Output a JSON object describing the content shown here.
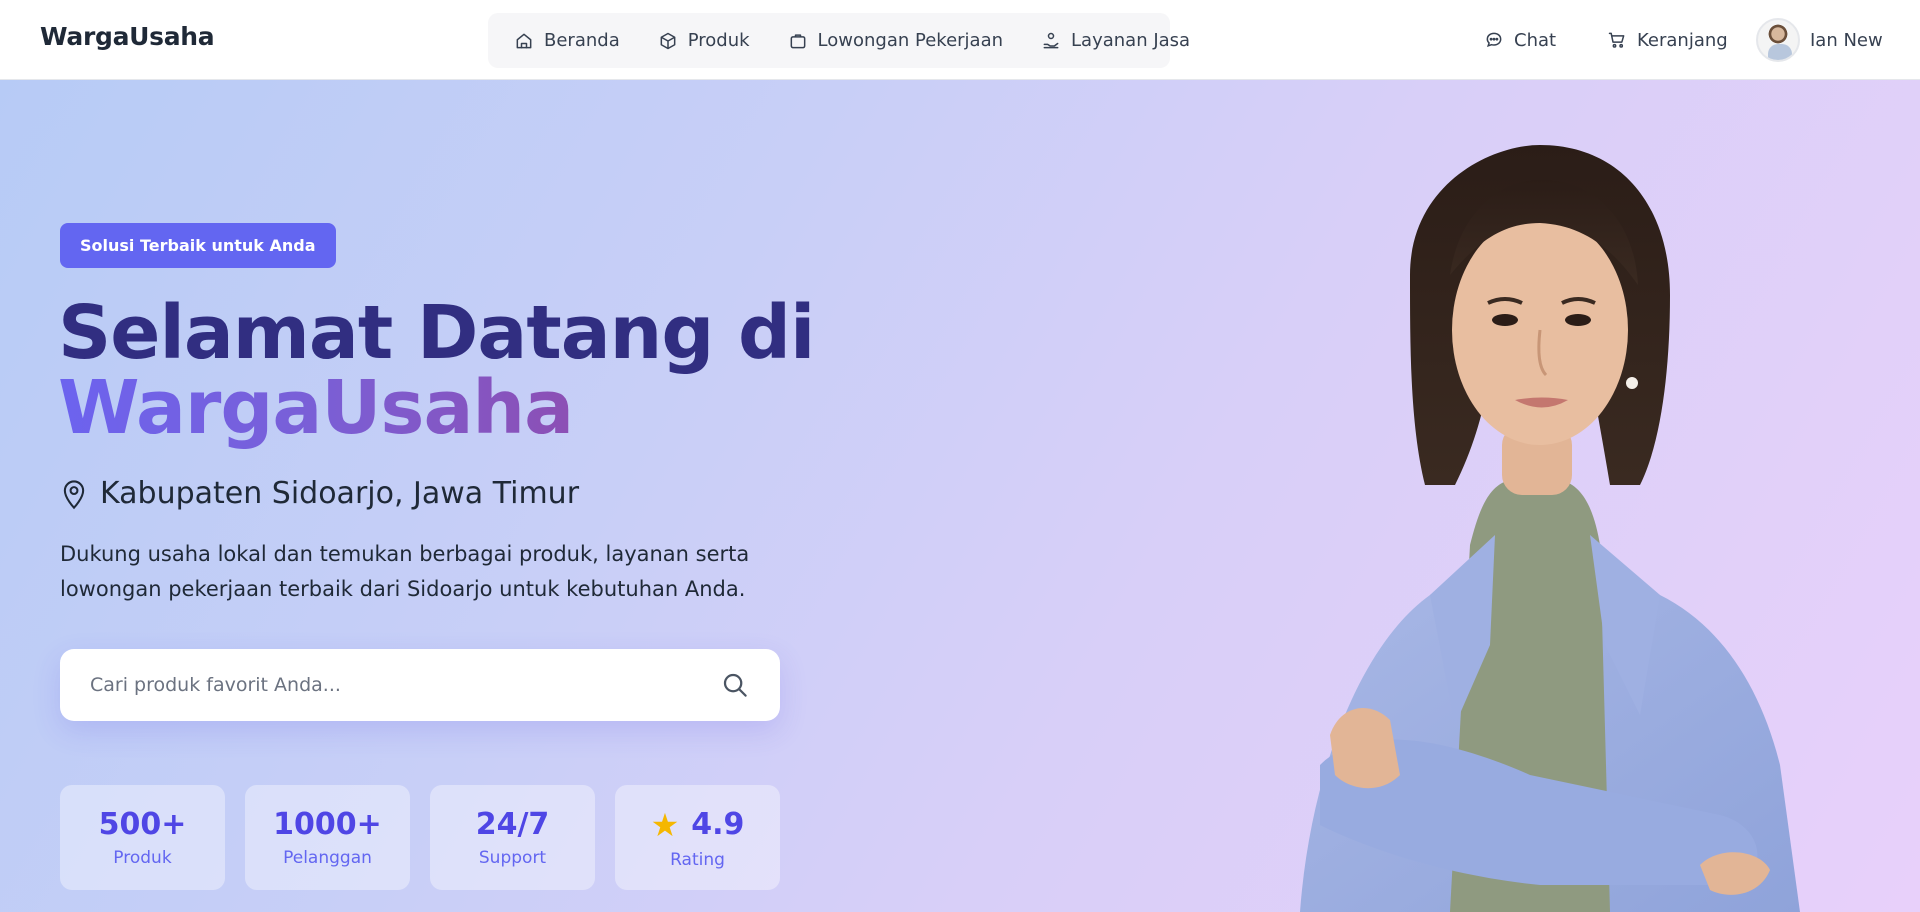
{
  "header": {
    "brand": "WargaUsaha",
    "nav": [
      {
        "label": "Beranda",
        "icon": "home-icon"
      },
      {
        "label": "Produk",
        "icon": "box-icon"
      },
      {
        "label": "Lowongan Pekerjaan",
        "icon": "briefcase-icon"
      },
      {
        "label": "Layanan Jasa",
        "icon": "service-hand-icon"
      }
    ],
    "chat_label": "Chat",
    "cart_label": "Keranjang",
    "user_name": "Ian New"
  },
  "hero": {
    "badge": "Solusi Terbaik untuk Anda",
    "title_line1": "Selamat Datang di",
    "title_line2": "WargaUsaha",
    "location": "Kabupaten Sidoarjo, Jawa Timur",
    "description": "Dukung usaha lokal dan temukan berbagai produk, layanan serta lowongan pekerjaan terbaik dari Sidoarjo untuk kebutuhan Anda.",
    "search_placeholder": "Cari produk favorit Anda...",
    "stats": [
      {
        "value": "500+",
        "label": "Produk"
      },
      {
        "value": "1000+",
        "label": "Pelanggan"
      },
      {
        "value": "24/7",
        "label": "Support"
      },
      {
        "value": "4.9",
        "label": "Rating",
        "icon": "star-icon"
      }
    ]
  },
  "colors": {
    "accent": "#6366f1",
    "title": "#312e81",
    "stat_value": "#4f46e5"
  }
}
